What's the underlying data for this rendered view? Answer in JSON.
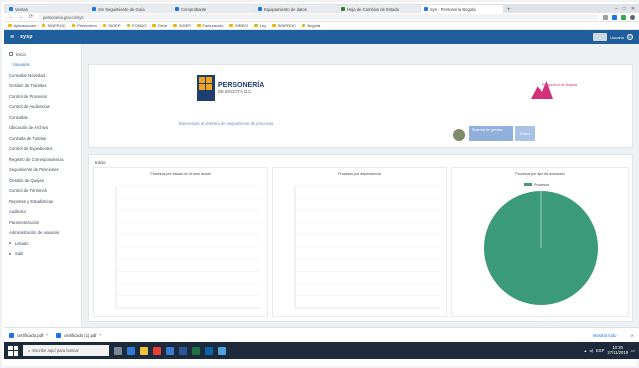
{
  "browser": {
    "tabs": [
      {
        "label": "Ventas",
        "color": "#1a73e8"
      },
      {
        "label": "Sin Seguimiento de Guía",
        "color": "#1a73e8"
      },
      {
        "label": "Comprobante",
        "color": "#1a73e8"
      },
      {
        "label": "Equipamiento de datos",
        "color": "#1a73e8"
      },
      {
        "label": "Hoja de Cambios de Estado",
        "color": "#2e7d32"
      },
      {
        "label": "Sys - Personería Bogotá",
        "color": "#1a73e8",
        "active": true
      }
    ],
    "url": "personeria.gov.co/sys",
    "bookmarks": [
      "Aplicaciones",
      "SINPROC",
      "Personería",
      "SIGEP",
      "FONDO",
      "Drive",
      "SIGEP",
      "Facturación",
      "SIRECI",
      "Ley",
      "SINPROC",
      "Bogotá"
    ]
  },
  "appbar": {
    "brand": "sysp",
    "user": "Usuario"
  },
  "sidebar": {
    "items": [
      {
        "label": "Inicio",
        "kind": "icon"
      },
      {
        "label": "Usuarios",
        "kind": "sub"
      },
      {
        "label": "Consultar Novedad",
        "kind": "plain"
      },
      {
        "label": "Gestión de Trámites",
        "kind": "plain"
      },
      {
        "label": "Control de Procesos",
        "kind": "plain"
      },
      {
        "label": "Control de Audiencias",
        "kind": "plain"
      },
      {
        "label": "Consultas",
        "kind": "plain"
      },
      {
        "label": "Ubicación de Archivo",
        "kind": "plain"
      },
      {
        "label": "Consulta de Tutelas",
        "kind": "plain"
      },
      {
        "label": "Control de Expedientes",
        "kind": "plain"
      },
      {
        "label": "Registro de Correspondencia",
        "kind": "plain"
      },
      {
        "label": "Seguimiento de Peticiones",
        "kind": "plain"
      },
      {
        "label": "Gestión de Quejas",
        "kind": "plain"
      },
      {
        "label": "Control de Términos",
        "kind": "plain"
      },
      {
        "label": "Reportes y Estadísticas",
        "kind": "plain"
      },
      {
        "label": "Auditoría",
        "kind": "plain"
      },
      {
        "label": "Parametrización",
        "kind": "plain"
      },
      {
        "label": "Administración de usuarios",
        "kind": "plain"
      },
      {
        "label": "Listado",
        "kind": "dot"
      },
      {
        "label": "Salir",
        "kind": "dot"
      }
    ]
  },
  "banner": {
    "logo_title": "PERSONERÍA",
    "logo_sub": "DE BOGOTÁ D.C.",
    "welcome": "Bienvenido al sistema de seguimiento de procesos",
    "right_logo": "Personería de Bogotá",
    "dept_label": "Sistema de gestión",
    "dept_button": "Entrar"
  },
  "section": {
    "title": "Inicio",
    "cards": [
      {
        "title": "Procesos por estado en el mes actual"
      },
      {
        "title": "Procesos por dependencia"
      },
      {
        "title": "Procesos por tipo de actuación"
      }
    ]
  },
  "chart_data": [
    {
      "type": "bar",
      "title": "Procesos por estado en el mes actual",
      "categories": [],
      "values": [],
      "grid": true
    },
    {
      "type": "bar",
      "title": "Procesos por dependencia",
      "categories": [],
      "values": [],
      "grid": true
    },
    {
      "type": "pie",
      "title": "Procesos por tipo de actuación",
      "series": [
        {
          "name": "Procesos",
          "values": [
            100
          ]
        }
      ],
      "colors": [
        "#3a9a7a"
      ],
      "legend": "top"
    }
  ],
  "downloads": [
    {
      "name": "certificado.pdf"
    },
    {
      "name": "certificado (1).pdf"
    }
  ],
  "downloads_show_all": "Mostrar todo",
  "taskbar": {
    "search": "Escribe aquí para buscar",
    "time": "10:30",
    "date": "27/11/2019",
    "lang": "ESP"
  },
  "colors": {
    "appbar": "#1e5e9c",
    "pie": "#3a9a7a",
    "accent": "#d3327a"
  }
}
